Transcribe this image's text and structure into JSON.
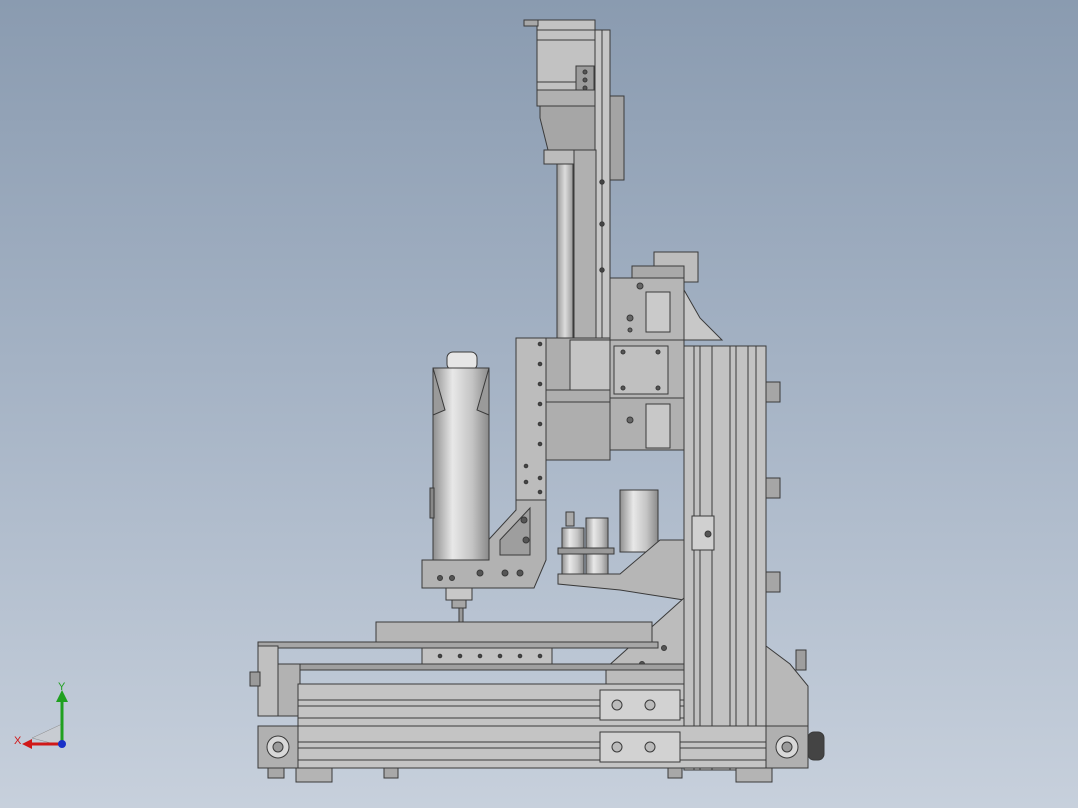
{
  "viewport": {
    "background_top": "#8a9bb0",
    "background_bottom": "#c7d0dc"
  },
  "triad": {
    "x_label": "X",
    "y_label": "Y",
    "x_color": "#d01818",
    "y_color": "#20a020",
    "z_color": "#1830c8"
  },
  "model": {
    "metal_light": "#d4d4d4",
    "metal_mid": "#b4b4b4",
    "metal_dark": "#8a8a8a",
    "line_color": "#3a3a3a"
  }
}
